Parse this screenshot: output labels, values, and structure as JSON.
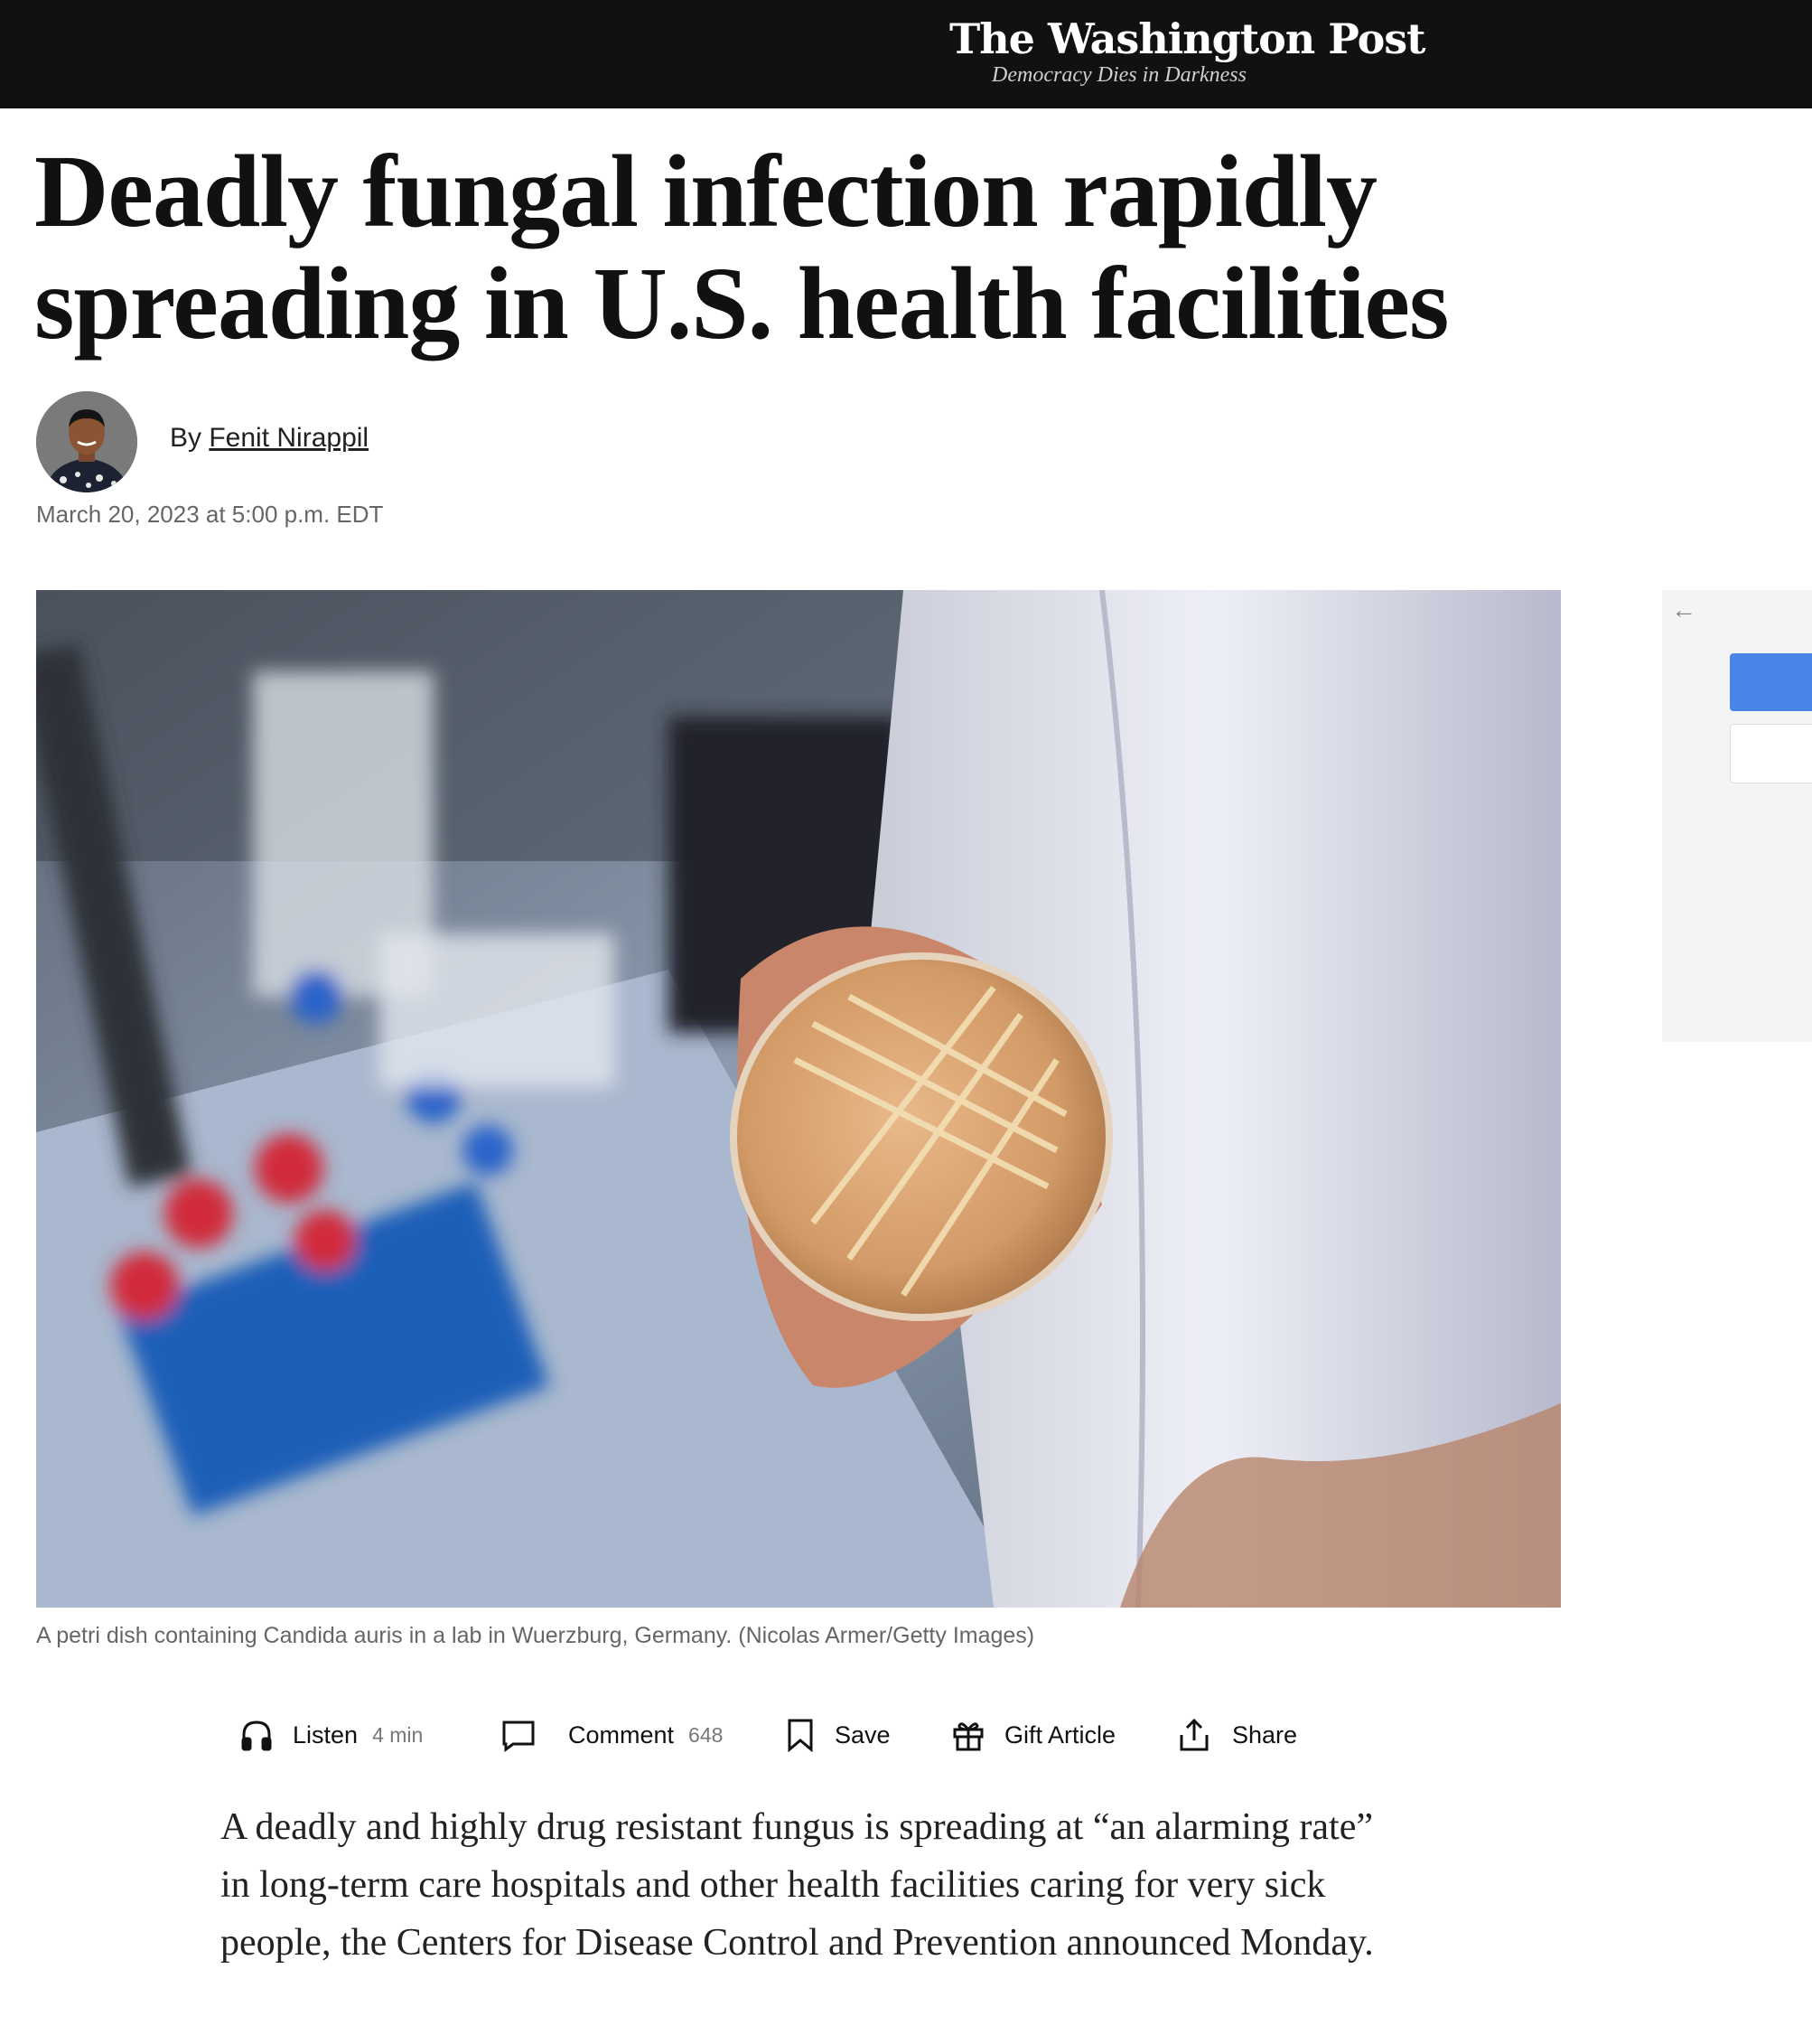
{
  "masthead": {
    "logo": "The Washington Post",
    "tagline": "Democracy Dies in Darkness"
  },
  "article": {
    "headline": "Deadly fungal infection rapidly spreading in U.S. health facilities",
    "byline_prefix": "By",
    "author": "Fenit Nirappil",
    "date": "March 20, 2023 at 5:00 p.m. EDT",
    "caption": "A petri dish containing Candida auris in a lab in Wuerzburg, Germany. (Nicolas Armer/Getty Images)",
    "lead": "A deadly and highly drug resistant fungus is spreading at “an alarming rate” in long-term care hospitals and other health facilities caring for very sick people, the Centers for Disease Control and Prevention announced Monday."
  },
  "actions": {
    "listen": {
      "label": "Listen",
      "count": "4 min",
      "icon": "headphones-icon"
    },
    "comment": {
      "label": "Comment",
      "count": "648",
      "icon": "comment-icon"
    },
    "save": {
      "label": "Save",
      "icon": "bookmark-icon"
    },
    "gift": {
      "label": "Gift Article",
      "icon": "gift-icon"
    },
    "share": {
      "label": "Share",
      "icon": "share-icon"
    }
  },
  "side_panel": {
    "back_icon": "arrow-left-icon",
    "accent": "#4a86e8"
  },
  "colors": {
    "topbar": "#111111",
    "text": "#111111",
    "meta": "#666666"
  }
}
